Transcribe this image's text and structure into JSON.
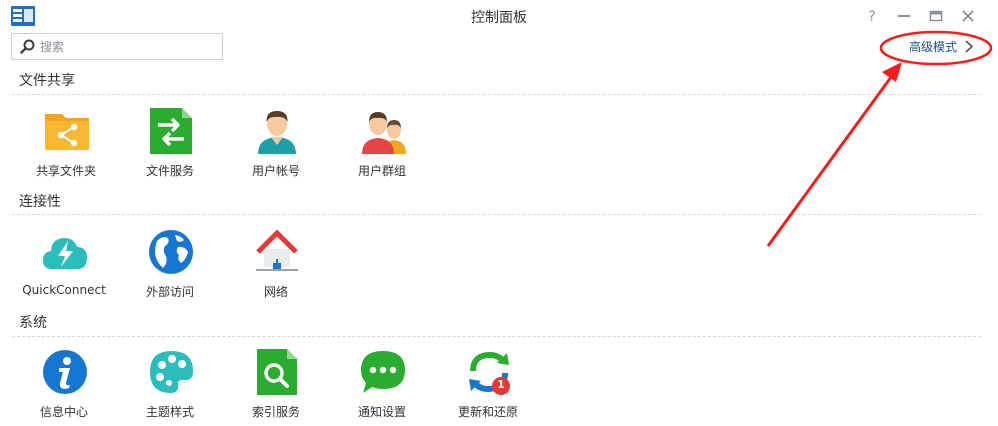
{
  "window": {
    "title": "控制面板"
  },
  "search": {
    "placeholder": "搜索",
    "value": ""
  },
  "advanced_mode": {
    "label": "高级模式"
  },
  "colors": {
    "link": "#1a4f9c",
    "annotation_red": "#ff1a1a",
    "folder_orange": "#f7a31c",
    "green": "#2aac2f",
    "blue": "#1677d2",
    "teal": "#2bbcbc",
    "badge_red": "#e53935"
  },
  "sections": [
    {
      "title": "文件共享",
      "items": [
        {
          "label": "共享文件夹",
          "icon": "shared-folder-icon"
        },
        {
          "label": "文件服务",
          "icon": "file-services-icon"
        },
        {
          "label": "用户帐号",
          "icon": "user-icon"
        },
        {
          "label": "用户群组",
          "icon": "group-icon"
        }
      ]
    },
    {
      "title": "连接性",
      "items": [
        {
          "label": "QuickConnect",
          "icon": "quickconnect-icon"
        },
        {
          "label": "外部访问",
          "icon": "globe-icon"
        },
        {
          "label": "网络",
          "icon": "network-house-icon"
        }
      ]
    },
    {
      "title": "系统",
      "items": [
        {
          "label": "信息中心",
          "icon": "info-icon"
        },
        {
          "label": "主题样式",
          "icon": "palette-icon"
        },
        {
          "label": "索引服务",
          "icon": "index-search-icon"
        },
        {
          "label": "通知设置",
          "icon": "chat-bubble-icon"
        },
        {
          "label": "更新和还原",
          "icon": "update-restore-icon",
          "badge": "1"
        }
      ]
    }
  ]
}
